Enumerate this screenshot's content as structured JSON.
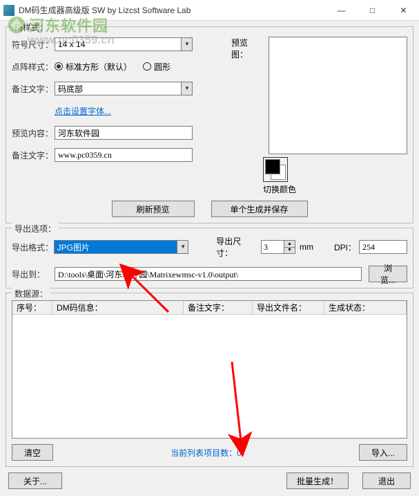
{
  "window": {
    "title": "DM码生成器高级版 SW  by Lizcst Software Lab",
    "min": "—",
    "max": "□",
    "close": "✕"
  },
  "watermark": {
    "cn": "河东软件园",
    "url": "www.pc0359.cn"
  },
  "style": {
    "group_label": "码样式：",
    "symbol_size_label": "符号尺寸：",
    "symbol_size_value": "14 x 14",
    "dot_style_label": "点阵样式：",
    "dot_style_std": "标准方形（默认）",
    "dot_style_round": "圆形",
    "note_pos_label": "备注文字：",
    "note_pos_value": "码底部",
    "font_link": "点击设置字体...",
    "preview_content_label": "预览内容：",
    "preview_content_value": "河东软件园",
    "note_text_label": "备注文字：",
    "note_text_value": "www.pc0359.cn",
    "preview_label": "预览图：",
    "swap_color_label": "切换颜色",
    "refresh_btn": "刷新预览",
    "single_gen_btn": "单个生成并保存"
  },
  "export": {
    "group_label": "导出选项：",
    "format_label": "导出格式：",
    "format_value": "JPG图片",
    "size_label": "导出尺寸：",
    "size_value": "3",
    "size_unit": "mm",
    "dpi_label": "DPI：",
    "dpi_value": "254",
    "out_label": "导出到：",
    "out_path": "D:\\tools\\桌面\\河东软件园\\Matrixewmsc-v1.0\\output\\",
    "browse_btn": "浏览..."
  },
  "datasource": {
    "group_label": "数据源：",
    "cols": {
      "seq": "序号：",
      "info": "DM码信息：",
      "note": "备注文字：",
      "filename": "导出文件名：",
      "status": "生成状态："
    },
    "clear_btn": "清空",
    "count_text": "当前列表项目数：0",
    "import_btn": "导入..."
  },
  "footer": {
    "about_btn": "关于...",
    "batch_btn": "批量生成！",
    "exit_btn": "退出"
  }
}
